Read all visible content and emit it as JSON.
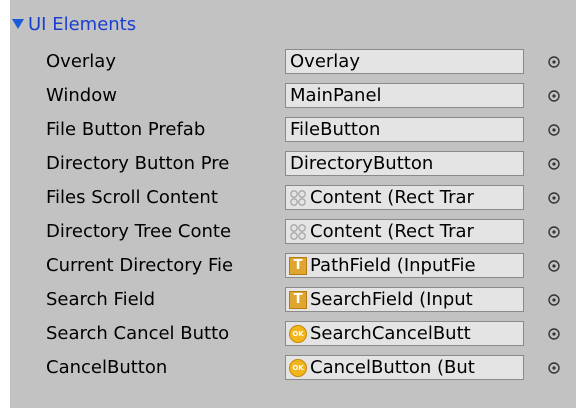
{
  "section": {
    "title": "UI Elements"
  },
  "fields": [
    {
      "label": "Overlay",
      "value": "Overlay",
      "icon": "none"
    },
    {
      "label": "Window",
      "value": "MainPanel",
      "icon": "none"
    },
    {
      "label": "File Button Prefab",
      "value": "FileButton",
      "icon": "none"
    },
    {
      "label": "Directory Button Pre",
      "value": "DirectoryButton",
      "icon": "none"
    },
    {
      "label": "Files Scroll Content",
      "value": "Content (Rect Trar",
      "icon": "rect-transform-icon"
    },
    {
      "label": "Directory Tree Conte",
      "value": "Content (Rect Trar",
      "icon": "rect-transform-icon"
    },
    {
      "label": "Current Directory Fie",
      "value": "PathField (InputFie",
      "icon": "input-field-icon"
    },
    {
      "label": "Search Field",
      "value": "SearchField (Input",
      "icon": "input-field-icon"
    },
    {
      "label": "Search Cancel Butto",
      "value": "SearchCancelButt",
      "icon": "button-icon"
    },
    {
      "label": "CancelButton",
      "value": "CancelButton (But",
      "icon": "button-icon"
    }
  ],
  "icons": {
    "input_field_glyph": "T",
    "button_glyph": "OK"
  },
  "colors": {
    "panel_background": "#c2c2c2",
    "field_background": "#e4e4e4",
    "header_text": "#1a3fd0",
    "foldout_arrow": "#1a5bd6"
  }
}
